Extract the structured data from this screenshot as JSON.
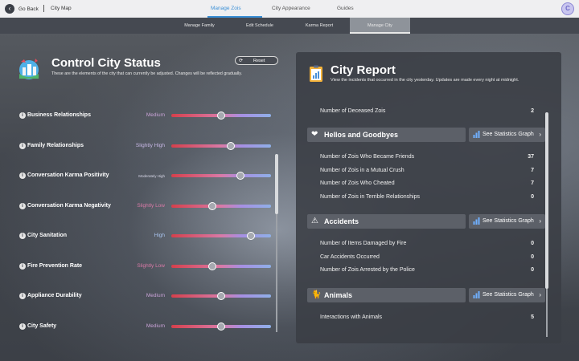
{
  "topbar": {
    "back_label": "Go Back",
    "city_map_label": "City Map",
    "tabs": [
      {
        "label": "Manage Zois",
        "active": true
      },
      {
        "label": "City Appearance",
        "active": false
      },
      {
        "label": "Guides",
        "active": false
      }
    ],
    "avatar_letter": "C"
  },
  "subtabs": [
    {
      "label": "Manage Family",
      "active": false
    },
    {
      "label": "Edit Schedule",
      "active": false
    },
    {
      "label": "Karma Report",
      "active": false
    },
    {
      "label": "Manage City",
      "active": true
    }
  ],
  "control": {
    "title": "Control City Status",
    "subtitle": "These are the elements of the city that can currently be adjusted. Changes will be reflected gradually.",
    "reset_label": "Reset",
    "sliders": [
      {
        "label": "Business Relationships",
        "level": "Medium",
        "level_color": "#c8a2d6",
        "value": 0.5
      },
      {
        "label": "Family Relationships",
        "level": "Slightly High",
        "level_color": "#c8b8e6",
        "value": 0.6
      },
      {
        "label": "Conversation Karma Positivity",
        "level": "Moderately High",
        "level_color": "#d8d8e8",
        "value": 0.69
      },
      {
        "label": "Conversation Karma Negativity",
        "level": "Slightly Low",
        "level_color": "#d97aa7",
        "value": 0.41
      },
      {
        "label": "City Sanitation",
        "level": "High",
        "level_color": "#a9c4ef",
        "value": 0.8
      },
      {
        "label": "Fire Prevention Rate",
        "level": "Slightly Low",
        "level_color": "#d97aa7",
        "value": 0.41
      },
      {
        "label": "Appliance Durability",
        "level": "Medium",
        "level_color": "#c8a2d6",
        "value": 0.5
      },
      {
        "label": "City Safety",
        "level": "Medium",
        "level_color": "#c8a2d6",
        "value": 0.5
      }
    ]
  },
  "report": {
    "title": "City Report",
    "subtitle": "View the incidents that occurred in the city yesterday. Updates are made every night at midnight.",
    "deceased": {
      "label": "Number of Deceased Zois",
      "value": "2"
    },
    "stat_link_label": "See Statistics Graph",
    "sections": [
      {
        "title": "Hellos and Goodbyes",
        "icon": "heart-icon",
        "rows": [
          {
            "label": "Number of Zois Who Became Friends",
            "value": "37"
          },
          {
            "label": "Number of Zois in a Mutual Crush",
            "value": "7"
          },
          {
            "label": "Number of Zois Who Cheated",
            "value": "7"
          },
          {
            "label": "Number of Zois in Terrible Relationships",
            "value": "0"
          }
        ]
      },
      {
        "title": "Accidents",
        "icon": "accident-icon",
        "rows": [
          {
            "label": "Number of Items Damaged by Fire",
            "value": "0"
          },
          {
            "label": "Car Accidents Occurred",
            "value": "0"
          },
          {
            "label": "Number of Zois Arrested by the Police",
            "value": "0"
          }
        ]
      },
      {
        "title": "Animals",
        "icon": "cat-icon",
        "rows": [
          {
            "label": "Interactions with Animals",
            "value": "5"
          }
        ]
      }
    ]
  }
}
